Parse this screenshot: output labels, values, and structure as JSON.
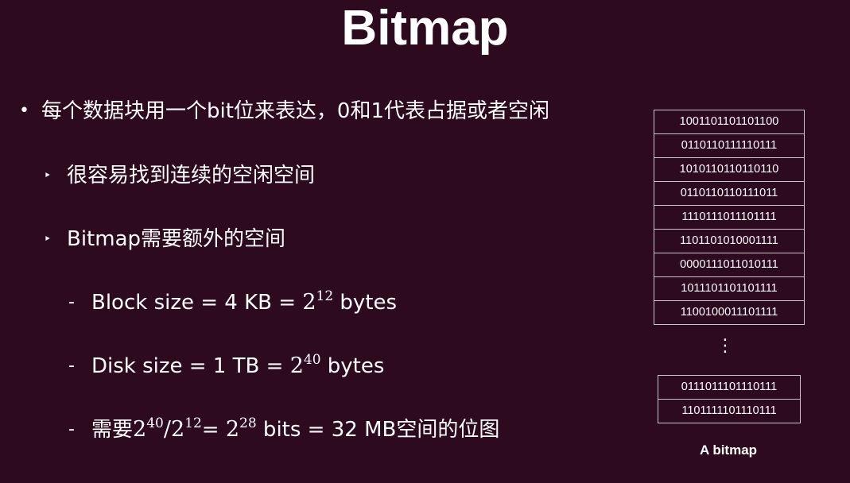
{
  "title": "Bitmap",
  "bullets": {
    "b1": {
      "marker": "•",
      "text": "每个数据块用一个bit位来表达，0和1代表占据或者空闲"
    },
    "b2": {
      "marker": "‣",
      "text": "很容易找到连续的空闲空间"
    },
    "b3": {
      "marker": "‣",
      "text": "Bitmap需要额外的空间"
    },
    "b4": {
      "marker": "-",
      "prefix": "Block size = 4 KB = ",
      "base": "2",
      "exp": "12",
      "suffix": " bytes"
    },
    "b5": {
      "marker": "-",
      "prefix": "Disk size = 1 TB = ",
      "base": "2",
      "exp": "40",
      "suffix": " bytes"
    },
    "b6": {
      "marker": "-",
      "prefix": "需要",
      "base1": "2",
      "exp1": "40",
      "slash": "/",
      "base2": "2",
      "exp2": "12",
      "eq": "= ",
      "base3": "2",
      "exp3": "28",
      "suffix": " bits = 32 MB空间的位图"
    }
  },
  "bitmap": {
    "rows_top": [
      "1001101101101100",
      "0110110111110111",
      "1010110110110110",
      "0110110110111011",
      "1110111011101111",
      "1101101010001111",
      "0000111011010111",
      "1011101101101111",
      "1100100011101111"
    ],
    "ellipsis": "⋮",
    "rows_bottom": [
      "0111011101110111",
      "1101111101110111"
    ],
    "caption": "A bitmap"
  }
}
